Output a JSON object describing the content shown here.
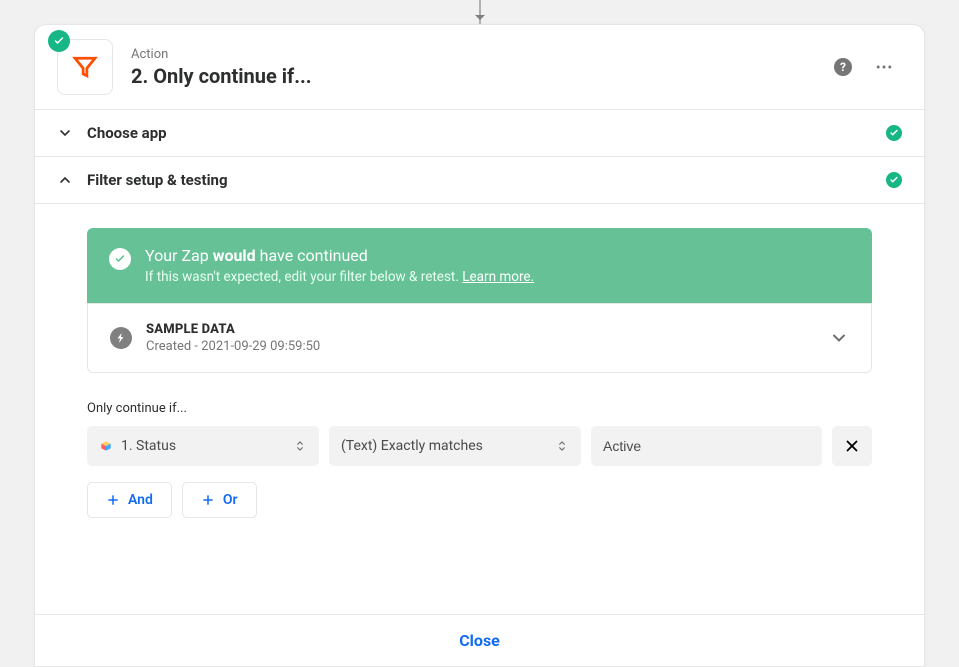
{
  "header": {
    "subtitle": "Action",
    "title": "2. Only continue if..."
  },
  "sections": {
    "choose_app": {
      "title": "Choose app",
      "complete": true,
      "expanded": false
    },
    "filter": {
      "title": "Filter setup & testing",
      "complete": true,
      "expanded": true
    }
  },
  "banner": {
    "prefix": "Your Zap ",
    "bold": "would",
    "suffix": " have continued",
    "desc": "If this wasn't expected, edit your filter below & retest. ",
    "link": "Learn more."
  },
  "sample": {
    "heading": "SAMPLE DATA",
    "detail": "Created - 2021-09-29 09:59:50"
  },
  "condition": {
    "label": "Only continue if...",
    "field": "1. Status",
    "operator": "(Text) Exactly matches",
    "value": "Active"
  },
  "bool": {
    "and": "And",
    "or": "Or"
  },
  "footer": {
    "close": "Close"
  }
}
